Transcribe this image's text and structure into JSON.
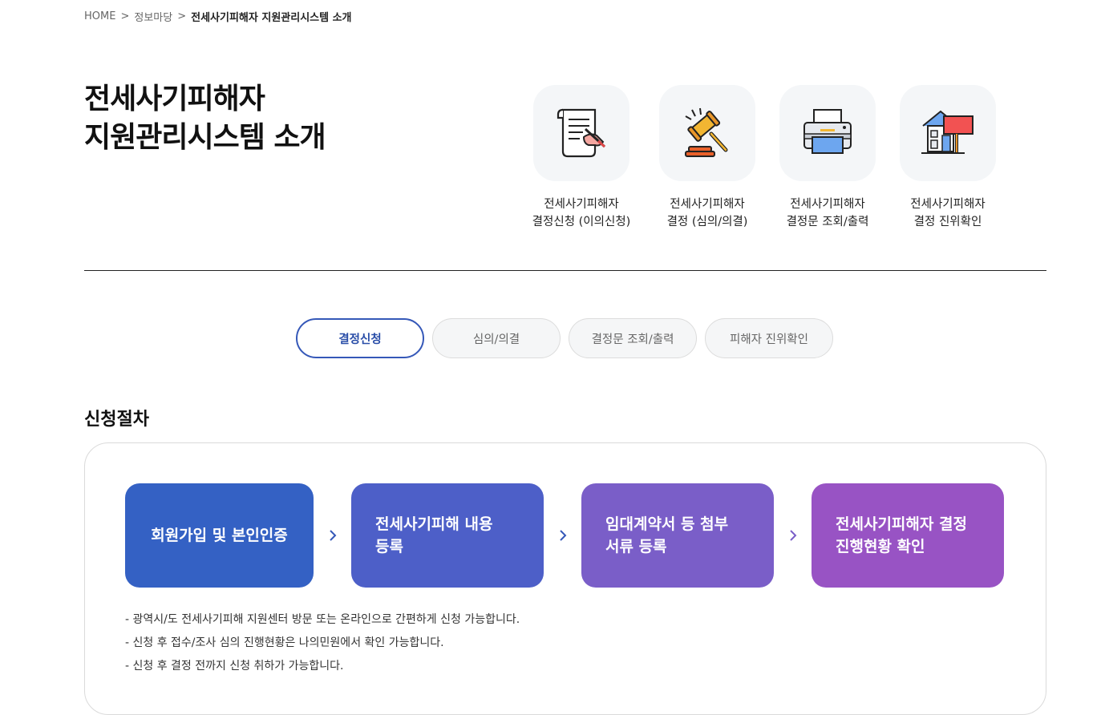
{
  "breadcrumb": {
    "home": "HOME",
    "level1": "정보마당",
    "current": "전세사기피해자 지원관리시스템 소개",
    "separator": ">"
  },
  "page_title": {
    "line1": "전세사기피해자",
    "line2": "지원관리시스템 소개"
  },
  "services": [
    {
      "icon": "document-sign-icon",
      "line1": "전세사기피해자",
      "line2": "결정신청 (이의신청)"
    },
    {
      "icon": "gavel-icon",
      "line1": "전세사기피해자",
      "line2": "결정 (심의/의결)"
    },
    {
      "icon": "printer-icon",
      "line1": "전세사기피해자",
      "line2": "결정문 조회/출력"
    },
    {
      "icon": "house-sign-icon",
      "line1": "전세사기피해자",
      "line2": "결정 진위확인"
    }
  ],
  "tabs": [
    {
      "label": "결정신청",
      "active": true
    },
    {
      "label": "심의/의결",
      "active": false
    },
    {
      "label": "결정문 조회/출력",
      "active": false
    },
    {
      "label": "피해자 진위확인",
      "active": false
    }
  ],
  "section_title": "신청절차",
  "steps": [
    {
      "line1": "회원가입 및 본인인증",
      "line2": "",
      "color": "#3461c4"
    },
    {
      "line1": "전세사기피해 내용",
      "line2": "등록",
      "color": "#4d5fc8"
    },
    {
      "line1": "임대계약서 등 첨부",
      "line2": "서류 등록",
      "color": "#7a5ec8"
    },
    {
      "line1": "전세사기피해자 결정",
      "line2": "진행현황 확인",
      "color": "#9853c4"
    }
  ],
  "notes": [
    "- 광역시/도 전세사기피해 지원센터 방문 또는 온라인으로 간편하게 신청 가능합니다.",
    "- 신청 후 접수/조사 심의 진행현황은 나의민원에서 확인 가능합니다.",
    "- 신청 후 결정 전까지 신청 취하가 가능합니다."
  ],
  "colors": {
    "accent": "#3558b8",
    "divider": "#222222"
  }
}
